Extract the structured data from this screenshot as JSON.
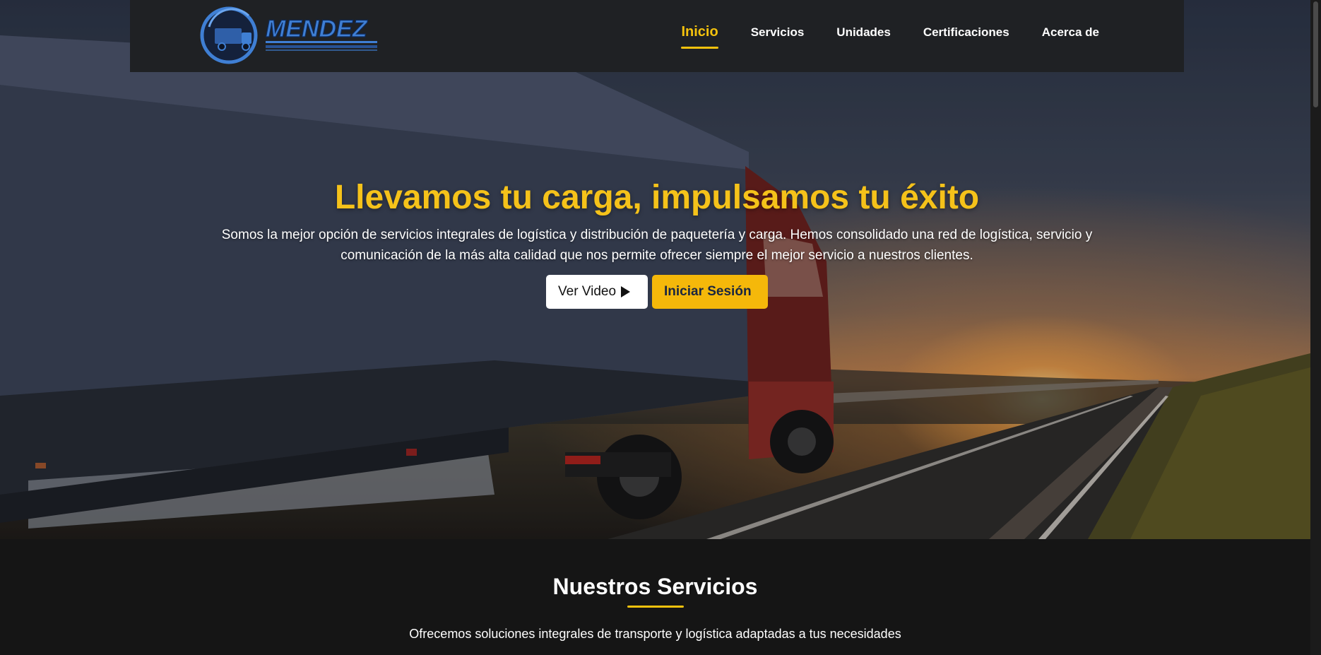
{
  "brand": {
    "name": "MENDEZ",
    "accent_color": "#f4c20d",
    "logo_blue": "#3f7fd4"
  },
  "nav": {
    "items": [
      {
        "label": "Inicio",
        "active": true
      },
      {
        "label": "Servicios",
        "active": false
      },
      {
        "label": "Unidades",
        "active": false
      },
      {
        "label": "Certificaciones",
        "active": false
      },
      {
        "label": "Acerca de",
        "active": false
      }
    ]
  },
  "hero": {
    "title": "Llevamos tu carga, impulsamos tu éxito",
    "description": "Somos la mejor opción de servicios integrales de logística y distribución de paquetería y carga. Hemos consolidado una red de logística, servicio y comunicación de la más alta calidad que nos permite ofrecer siempre el mejor servicio a nuestros clientes.",
    "video_button": "Ver Video",
    "video_icon": "play-icon",
    "login_button": "Iniciar Sesión"
  },
  "services": {
    "title": "Nuestros Servicios",
    "subtitle": "Ofrecemos soluciones integrales de transporte y logística adaptadas a tus necesidades"
  }
}
